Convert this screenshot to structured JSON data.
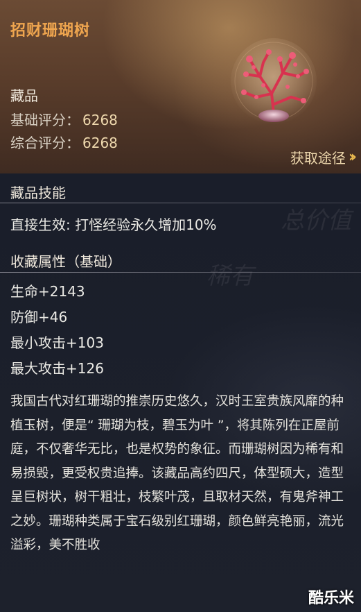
{
  "item": {
    "name": "招财珊瑚树",
    "category": "藏品",
    "base_score_label": "基础评分：",
    "base_score": "6268",
    "total_score_label": "综合评分：",
    "total_score": "6268",
    "obtain_label": "获取途径",
    "icon": "coral-tree-icon"
  },
  "skill": {
    "header": "藏品技能",
    "text": "直接生效: 打怪经验永久增加10%"
  },
  "attributes": {
    "header": "收藏属性（基础）",
    "items": [
      "生命+2143",
      "防御+46",
      "最小攻击+103",
      "最大攻击+126"
    ]
  },
  "description": "我国古代对红珊瑚的推崇历史悠久，汉时王室贵族风靡的种植玉树，便是“ 珊瑚为枝，碧玉为叶 ”，将其陈列在正屋前庭，不仅奢华无比，也是权势的象征。而珊瑚树因为稀有和易损毁，更受权贵追捧。该藏品高约四尺，体型硕大，造型呈巨树状，树干粗壮，枝繁叶茂，且取材天然，有鬼斧神工之妙。珊瑚种类属于宝石级别红珊瑚，颜色鲜亮艳丽，流光溢彩，美不胜收",
  "background_text": [
    "总价值",
    "稀有"
  ],
  "watermark": "酷乐米",
  "colors": {
    "title": "#f0a64f",
    "score_value": "#efd9ae",
    "arrow": "#e8b84e"
  }
}
